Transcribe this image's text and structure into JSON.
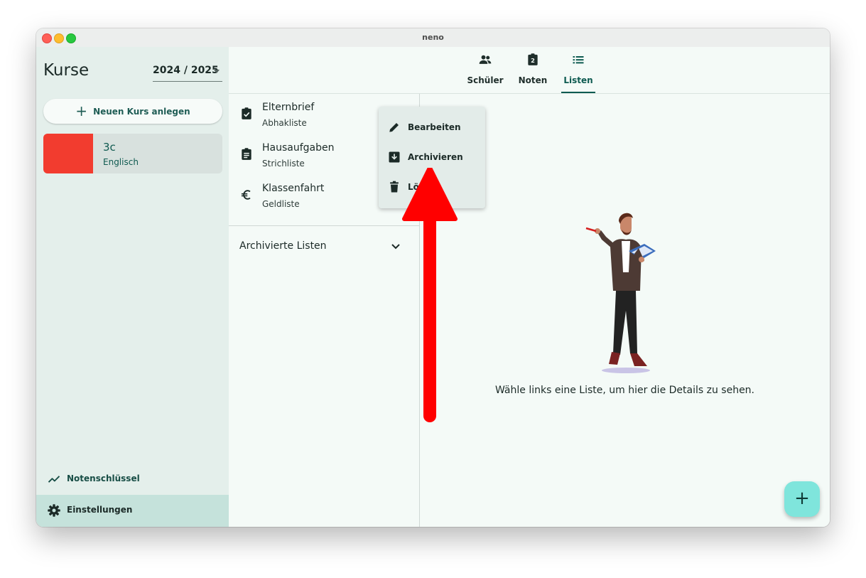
{
  "window": {
    "title": "neno"
  },
  "sidebar": {
    "title": "Kurse",
    "year": "2024 / 2025",
    "new_course_label": "Neuen Kurs anlegen",
    "courses": [
      {
        "name": "3c",
        "subject": "Englisch",
        "color": "#f23c2f"
      }
    ],
    "grading_key_label": "Notenschlüssel",
    "settings_label": "Einstellungen"
  },
  "tabs": [
    {
      "label": "Schüler",
      "icon": "people-icon",
      "active": false
    },
    {
      "label": "Noten",
      "icon": "grade-clipboard-icon",
      "active": false
    },
    {
      "label": "Listen",
      "icon": "list-icon",
      "active": true
    }
  ],
  "lists": [
    {
      "title": "Elternbrief",
      "subtitle": "Abhakliste",
      "icon": "clipboard-check-icon"
    },
    {
      "title": "Hausaufgaben",
      "subtitle": "Strichliste",
      "icon": "clipboard-text-icon"
    },
    {
      "title": "Klassenfahrt",
      "subtitle": "Geldliste",
      "icon": "euro-icon"
    }
  ],
  "archived_label": "Archivierte Listen",
  "context_menu": {
    "items": [
      {
        "label": "Bearbeiten",
        "icon": "pencil-icon"
      },
      {
        "label": "Archivieren",
        "icon": "archive-icon"
      },
      {
        "label": "Lö",
        "icon": "trash-icon"
      }
    ]
  },
  "detail": {
    "empty_text": "Wähle links eine Liste, um hier die Details zu sehen."
  },
  "fab_label": "+",
  "colors": {
    "accent": "#0e5b51",
    "sidebar_bg": "#e4efeb",
    "fab": "#7fe5dc",
    "annotation_arrow": "#ff0000"
  }
}
